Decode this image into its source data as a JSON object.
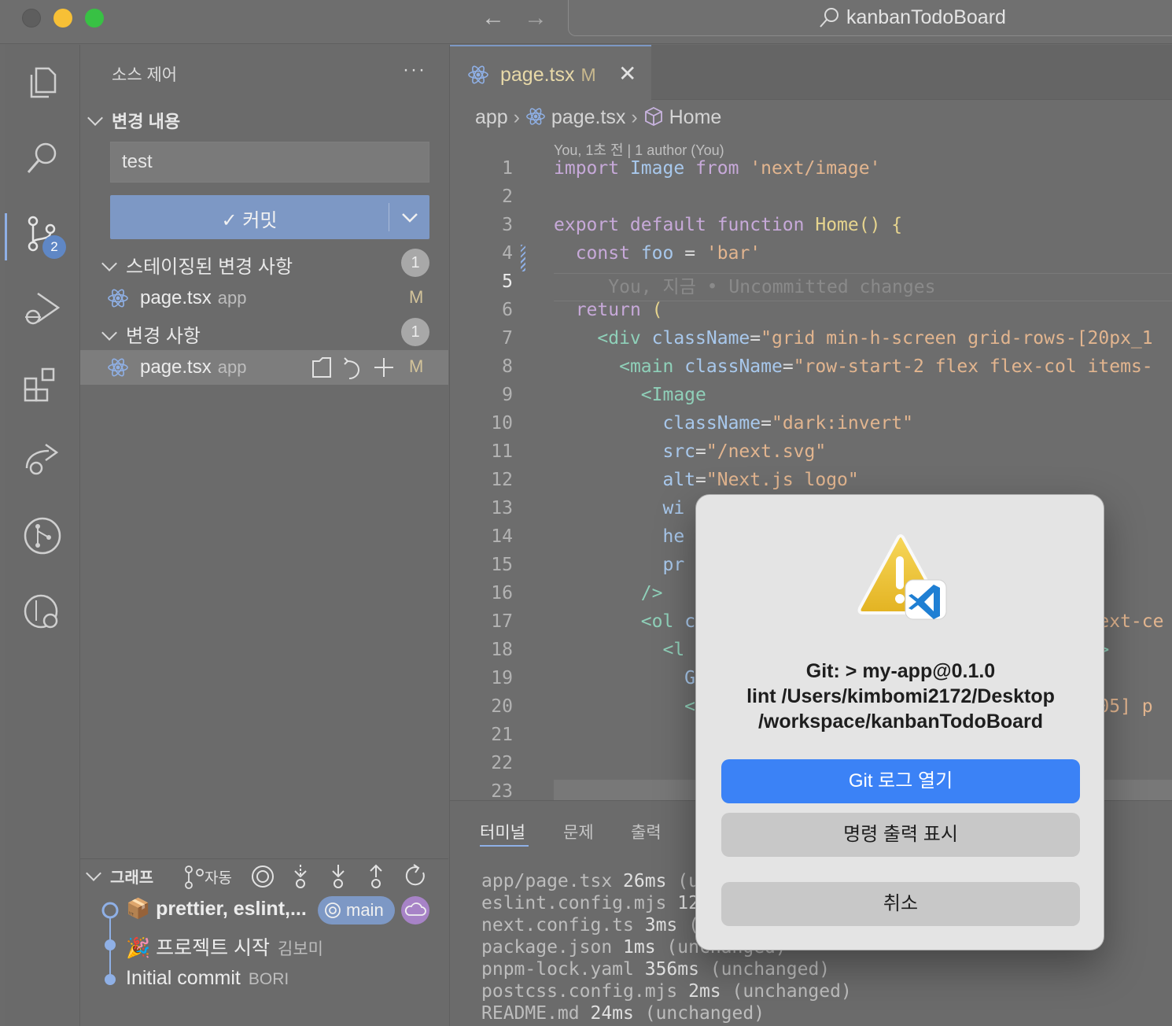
{
  "window": {
    "title": "kanbanTodoBoard"
  },
  "activity_bar": {
    "items": [
      "explorer-icon",
      "search-icon",
      "source-control-icon",
      "run-debug-icon",
      "extensions-icon",
      "remote-icon",
      "git-graph-icon",
      "git-history-icon"
    ],
    "scm_badge": "2"
  },
  "sidebar": {
    "title": "소스 제어",
    "more": "···",
    "changes_section": "변경 내용",
    "commit_message": "test",
    "commit_button": "✓ 커밋",
    "staged": {
      "label": "스테이징된 변경 사항",
      "count": "1",
      "file": {
        "name": "page.tsx",
        "dir": "app",
        "status": "M"
      }
    },
    "unstaged": {
      "label": "변경 사항",
      "count": "1",
      "file": {
        "name": "page.tsx",
        "dir": "app",
        "status": "M"
      }
    },
    "graph": {
      "title": "그래프",
      "auto_label": "자동",
      "commits": [
        {
          "message": "📦 prettier, eslint,...",
          "author": ""
        },
        {
          "message": "🎉 프로젝트 시작",
          "author": "김보미"
        },
        {
          "message": "Initial commit",
          "author": "BORI"
        }
      ],
      "branch_tag": "main"
    }
  },
  "editor": {
    "tab": {
      "name": "page.tsx",
      "status": "M"
    },
    "breadcrumb": {
      "folder": "app",
      "file": "page.tsx",
      "symbol": "Home"
    },
    "blame": "You, 1초 전 | 1 author (You)",
    "inline_blame": "You, 지금 • Uncommitted changes",
    "line_numbers": [
      "1",
      "2",
      "3",
      "4",
      "5",
      "6",
      "7",
      "8",
      "9",
      "10",
      "11",
      "12",
      "13",
      "14",
      "15",
      "16",
      "17",
      "18",
      "19",
      "20",
      "21",
      "22",
      "23"
    ],
    "current_line": "5"
  },
  "panel": {
    "tabs": [
      "터미널",
      "문제",
      "출력"
    ],
    "terminal_lines": [
      {
        "file": "app/page.tsx",
        "ms": "26ms",
        "rest": " (u"
      },
      {
        "file": "eslint.config.mjs",
        "ms": "12",
        "rest": ""
      },
      {
        "file": "next.config.ts",
        "ms": "3ms",
        "rest": " ("
      },
      {
        "file": "package.json",
        "ms": "1ms",
        "rest": " (unchanged)"
      },
      {
        "file": "pnpm-lock.yaml",
        "ms": "356ms",
        "rest": " (unchanged)"
      },
      {
        "file": "postcss.config.mjs",
        "ms": "2ms",
        "rest": " (unchanged)"
      },
      {
        "file": "README.md",
        "ms": "24ms",
        "rest": " (unchanged)"
      }
    ]
  },
  "dialog": {
    "message_lines": [
      "Git: > my-app@0.1.0",
      "lint /Users/kimbomi2172/Desktop",
      "/workspace/kanbanTodoBoard"
    ],
    "primary_button": "Git 로그 열기",
    "secondary_button": "명령 출력 표시",
    "cancel_button": "취소"
  },
  "colors": {
    "accent": "#7d98c5",
    "dialog_primary": "#3b82f6",
    "modified": "#d3c39a"
  }
}
